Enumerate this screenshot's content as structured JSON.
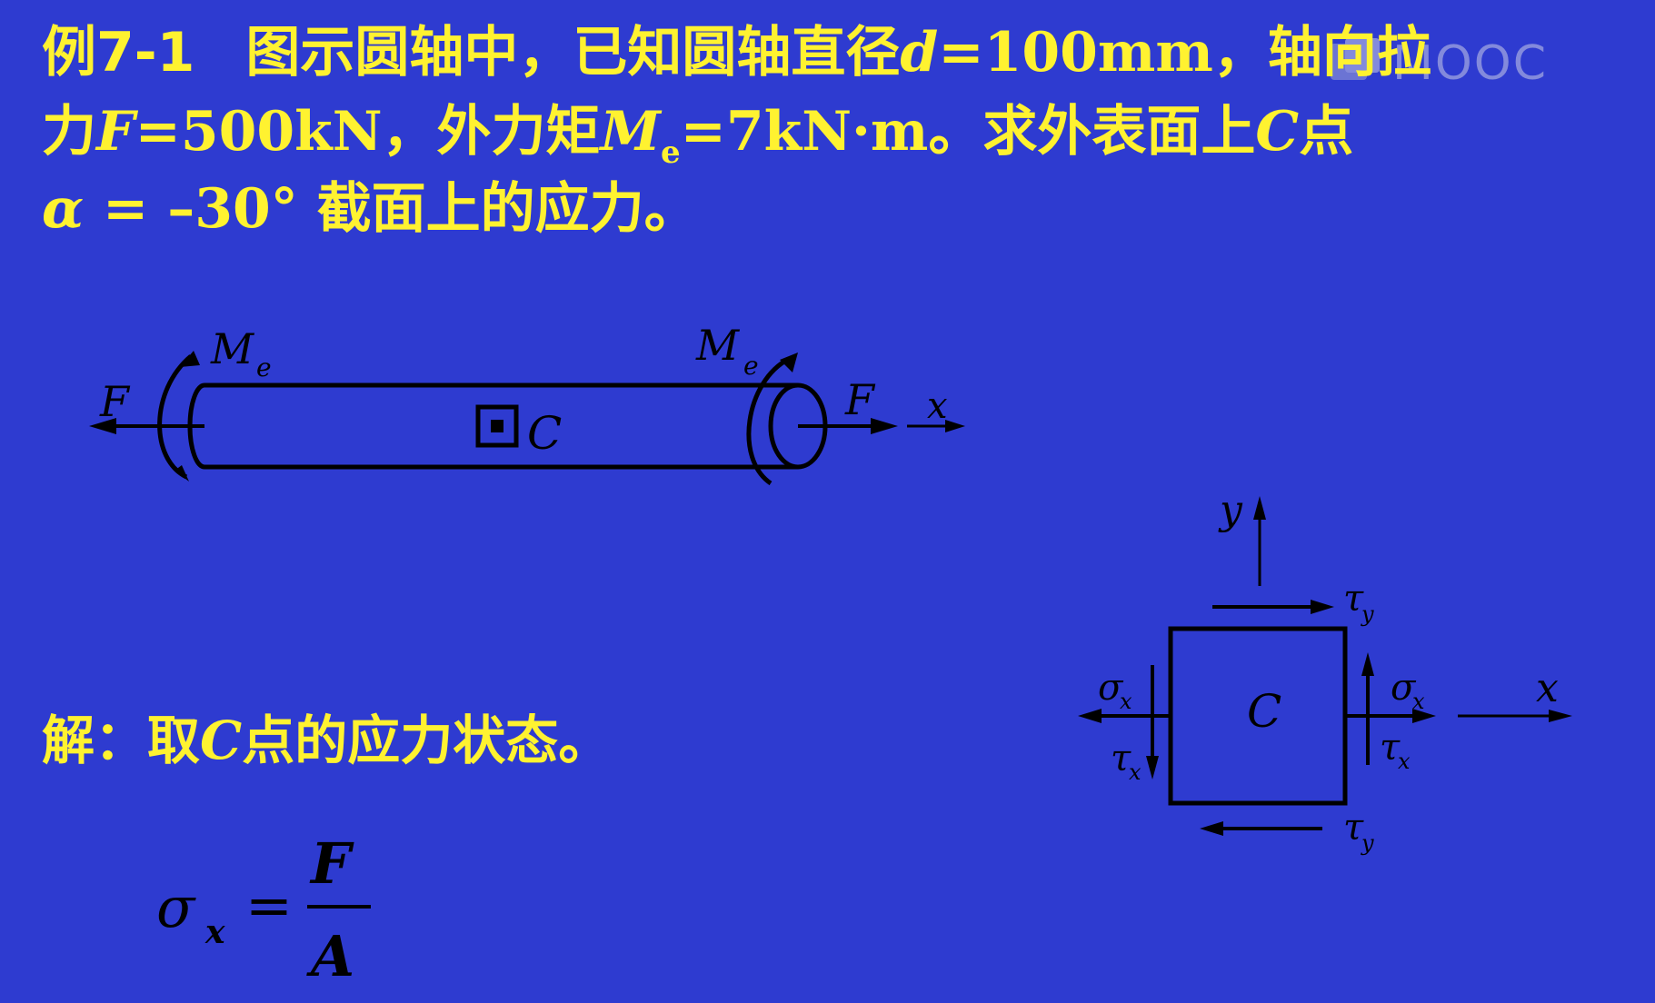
{
  "watermark": {
    "text": "MOOC"
  },
  "problem": {
    "label": "例7-1",
    "line1_a": "图示圆轴中，已知圆轴直径",
    "sym_d": "d",
    "line1_b": "=100mm，轴向拉",
    "line2_a": "力",
    "sym_F": "F",
    "line2_b": "=500kN，外力矩",
    "sym_M": "M",
    "sub_e": "e",
    "line2_c": "=7kN·m。求外表面上",
    "sym_C": "C",
    "line2_d": "点",
    "sym_alpha": "α",
    "line3_a": " = –30°",
    "line3_b": " 截面上的应力。"
  },
  "shaft_diagram": {
    "left_force": "F",
    "right_force": "F",
    "left_moment": "M",
    "left_moment_sub": "e",
    "right_moment": "M",
    "right_moment_sub": "e",
    "point": "C",
    "axis": "x"
  },
  "element_diagram": {
    "y_axis": "y",
    "x_axis": "x",
    "center": "C",
    "tau": "τ",
    "sigma": "σ",
    "sub_x": "x",
    "sub_y": "y"
  },
  "solution": {
    "prefix": "解：取",
    "sym_C": "C",
    "suffix": "点的应力状态。"
  },
  "formula": {
    "lhs": "σ",
    "lhs_sub": "x",
    "eq": "=",
    "numerator": "F",
    "denominator": "A"
  }
}
